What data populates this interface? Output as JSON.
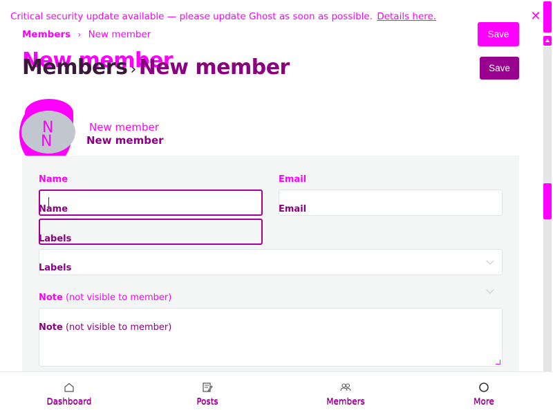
{
  "banner": {
    "message": "Critical security update available — please update Ghost as soon as possible.",
    "link_label": "Details here.",
    "close_icon": "close-icon"
  },
  "breadcrumb": {
    "parent": "Members",
    "separator": "›",
    "current": "New member"
  },
  "header": {
    "title_parent": "Members",
    "title_separator": "›",
    "title_current": "New member",
    "title_ghost": "New member",
    "save_label": "Save",
    "save_top_label": "Save"
  },
  "avatar": {
    "initials": "N",
    "initials_ghost": "N",
    "name_ghost": "New member",
    "name": "New member"
  },
  "form": {
    "name_label": "Name",
    "email_label": "Email",
    "labels_label": "Labels",
    "note_label": "Note",
    "note_hint": "(not visible to member)",
    "name_value": "",
    "email_value": "",
    "note_value": ""
  },
  "nav": {
    "items": [
      {
        "label": "Dashboard",
        "icon": "home-icon"
      },
      {
        "label": "Posts",
        "icon": "edit-icon"
      },
      {
        "label": "Members",
        "icon": "members-icon"
      },
      {
        "label": "More",
        "icon": "more-circle-icon"
      }
    ]
  },
  "colors": {
    "accent": "#ff00ff",
    "primary": "#9a008f",
    "card_bg": "#f4f5f5"
  }
}
